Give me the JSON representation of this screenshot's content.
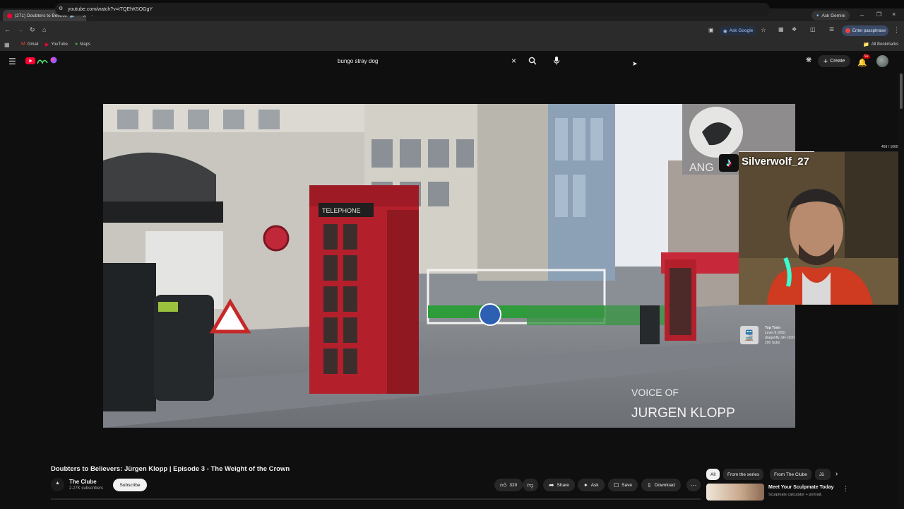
{
  "browser": {
    "tab_title": "(271) Doubters to Believers",
    "ask_gemini": "Ask Gemini",
    "url": "youtube.com/watch?v=tTQEhK5OGgY",
    "ask_google": "Ask Google",
    "passphrase": "Enter passphrase",
    "bookmarks": [
      "Gmail",
      "YouTube",
      "Maps"
    ],
    "all_bookmarks": "All Bookmarks"
  },
  "youtube": {
    "search_query": "bungo stray dog",
    "create_label": "Create",
    "notification_count": "9+"
  },
  "video": {
    "booth_sign": "TELEPHONE",
    "storefront_text": "ANG",
    "caption_line1": "VOICE OF",
    "caption_line2": "JURGEN KLOPP"
  },
  "stream_overlay": {
    "username": "Silverwolf_27",
    "progress_text": "459 / 1000",
    "train_title": "Top Train",
    "train_level": "Level 9 (265)",
    "train_user": "dragonfly_ktv x200",
    "train_subs": "200 Subs"
  },
  "meta": {
    "title": "Doubters to Believers: Jürgen Klopp | Episode 3 - The Weight of the Crown",
    "channel": "The Clube",
    "subscribers": "2.27K subscribers",
    "subscribe_label": "Subscribe",
    "like_count": "320",
    "share_label": "Share",
    "ask_label": "Ask",
    "save_label": "Save",
    "download_label": "Download"
  },
  "sidebar": {
    "chips": [
      "All",
      "From the series",
      "From The Clube",
      "Jü"
    ],
    "rec_title": "Meet Your Sculpmate Today",
    "rec_subtitle": "Sculpmate calculator + portrait."
  },
  "colors": {
    "youtube_red": "#ff0033",
    "accent_blue": "#a8c7fa",
    "booth_red": "#b3202b"
  }
}
